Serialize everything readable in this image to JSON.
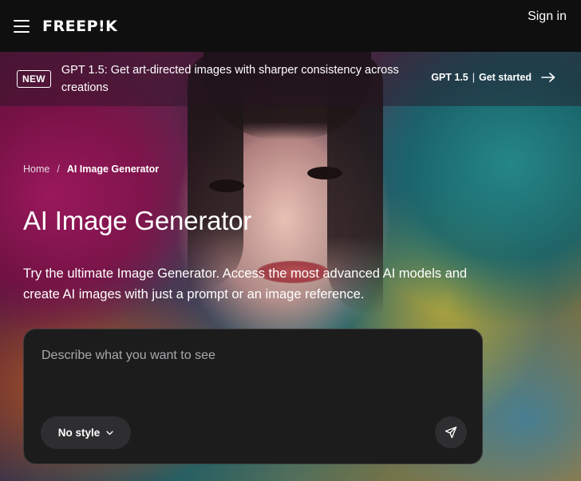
{
  "header": {
    "logo_text": "FREEP!K",
    "menu_icon": "hamburger-menu-icon",
    "signin_label": "Sign in"
  },
  "banner": {
    "badge": "NEW",
    "text": "GPT 1.5: Get art-directed images with sharper consistency across creations",
    "cta_model": "GPT 1.5",
    "cta_separator": "|",
    "cta_label": "Get started",
    "cta_icon": "arrow-right-icon"
  },
  "breadcrumb": {
    "home": "Home",
    "separator": "/",
    "current": "AI Image Generator"
  },
  "hero": {
    "title": "AI Image Generator",
    "subtitle": "Try the ultimate Image Generator. Access the most advanced AI models and create AI images with just a prompt or an image reference."
  },
  "prompt": {
    "placeholder": "Describe what you want to see",
    "value": "",
    "style_label": "No style",
    "style_icon": "chevron-down-icon",
    "send_icon": "send-icon"
  },
  "colors": {
    "topbar_bg": "#0f0f10",
    "prompt_bg": "#1c1c1d",
    "button_bg": "#2e2e30",
    "text": "#ffffff"
  }
}
